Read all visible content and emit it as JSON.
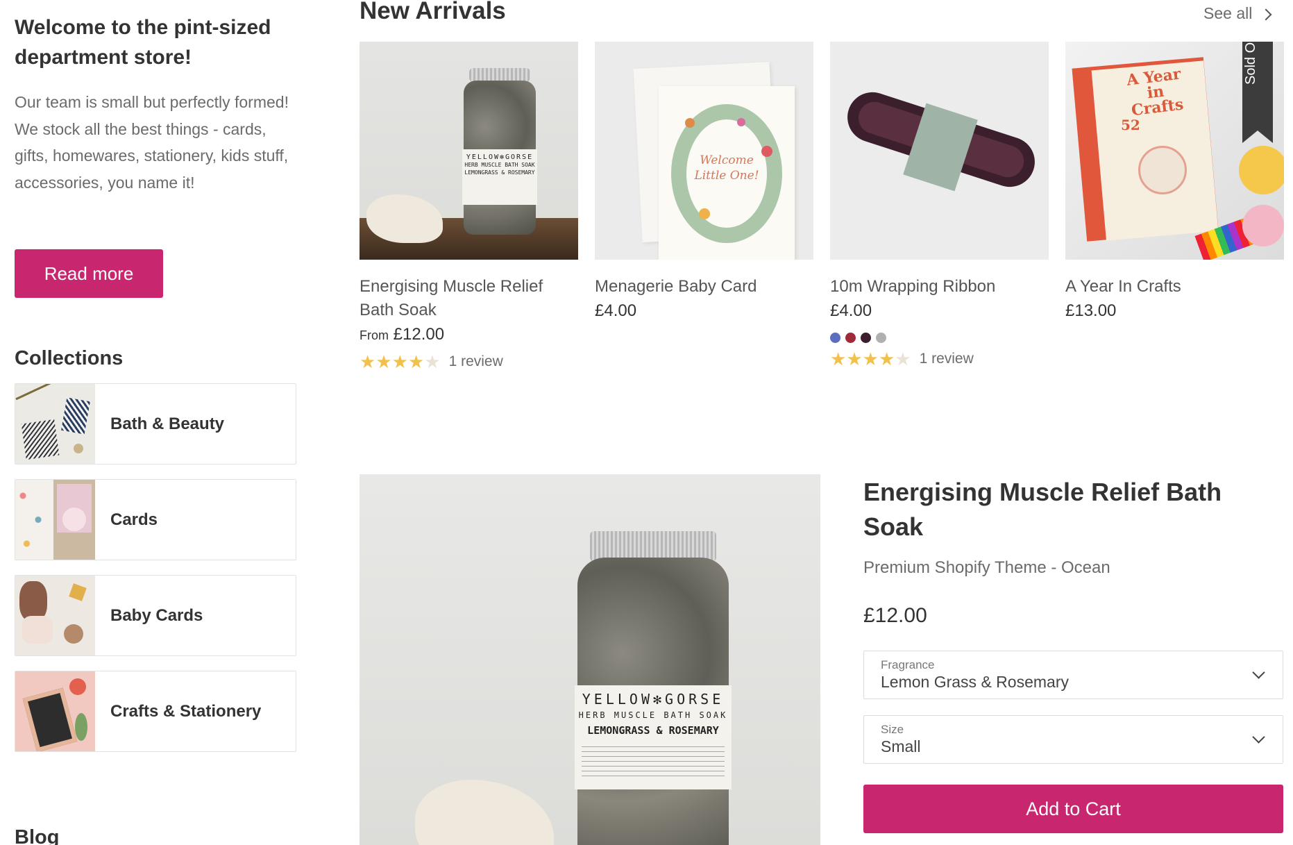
{
  "sidebar": {
    "welcome": "Welcome to the pint-sized department store!",
    "intro": "Our team is small but perfectly formed! We stock all the best things  - cards, gifts, homewares, stationery, kids stuff, accessories, you name it!",
    "read_more": "Read more",
    "collections_title": "Collections",
    "collections": [
      {
        "label": "Bath & Beauty"
      },
      {
        "label": "Cards"
      },
      {
        "label": "Baby Cards"
      },
      {
        "label": "Crafts & Stationery"
      }
    ],
    "blog_title": "Blog"
  },
  "new_arrivals": {
    "title": "New Arrivals",
    "see_all": "See all",
    "products": [
      {
        "name": "Energising Muscle Relief Bath Soak",
        "price_prefix": "From",
        "price": "£12.00",
        "rating": 4,
        "reviews": "1 review"
      },
      {
        "name": "Menagerie Baby Card",
        "price": "£4.00"
      },
      {
        "name": "10m Wrapping Ribbon",
        "price": "£4.00",
        "swatches": [
          "#5a6fc0",
          "#a12a3a",
          "#3b1f2c",
          "#b0b0b0"
        ],
        "rating": 4,
        "reviews": "1 review"
      },
      {
        "name": "A Year In Crafts",
        "price": "£13.00",
        "badge": "Sold Out"
      }
    ]
  },
  "featured": {
    "title": "Energising Muscle Relief Bath Soak",
    "vendor": "Premium Shopify Theme - Ocean",
    "price": "£12.00",
    "fragrance_label": "Fragrance",
    "fragrance_value": "Lemon Grass & Rosemary",
    "size_label": "Size",
    "size_value": "Small",
    "add_to_cart": "Add to Cart"
  },
  "product_art": {
    "jar_label_brand": "YELLOW✻GORSE",
    "jar_label_line": "HERB MUSCLE BATH SOAK",
    "jar_label_scent": "LEMONGRASS & ROSEMARY",
    "card_script": "Welcome Little One!",
    "book_title": "A Year in Crafts",
    "book_number": "52"
  },
  "colors": {
    "accent": "#c8276f",
    "star": "#f1c14a",
    "text": "#333333",
    "muted": "#6b6b6b"
  }
}
